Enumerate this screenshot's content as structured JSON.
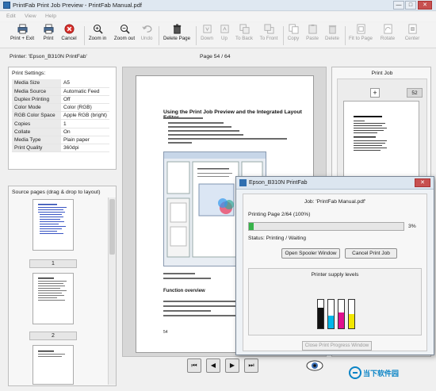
{
  "window": {
    "title": "PrintFab Print Job Preview - PrintFab Manual.pdf",
    "minimize": "—",
    "maximize": "□",
    "close": "✕"
  },
  "menu": [
    "Edit",
    "View",
    "Help"
  ],
  "toolbar": {
    "print_exit": "Print + Exit",
    "print": "Print",
    "cancel": "Cancel",
    "zoom_in": "Zoom in",
    "zoom_out": "Zoom out",
    "undo": "Undo",
    "delete_page": "Delete Page",
    "down": "Down",
    "up": "Up",
    "to_back": "To Back",
    "to_front": "To Front",
    "copy": "Copy",
    "paste": "Paste",
    "delete": "Delete",
    "fit_to_page": "Fit to Page",
    "rotate": "Rotate",
    "center": "Center"
  },
  "printer_label": "Printer: 'Epson_B310N PrintFab'",
  "page_indicator": "Page 54 / 64",
  "settings": {
    "header": "Print Settings:",
    "rows": [
      [
        "Media Size",
        "A5"
      ],
      [
        "Media Source",
        "Automatic Feed"
      ],
      [
        "Duplex Printing",
        "Off"
      ],
      [
        "Color Mode",
        "Color (RGB)"
      ],
      [
        "RGB Color Space",
        "Apple RGB (bright)"
      ],
      [
        "Copies",
        "1"
      ],
      [
        "Collate",
        "On"
      ],
      [
        "Media Type",
        "Plain paper"
      ],
      [
        "Print Quality",
        "360dpi"
      ]
    ]
  },
  "source": {
    "header": "Source pages (drag & drop to layout)",
    "pages": [
      "1",
      "2"
    ]
  },
  "document": {
    "title": "Using the Print Job Preview and the Integrated Layout Editor",
    "section": "Function overview",
    "page_num": "54"
  },
  "printjob": {
    "header": "Print Job",
    "add": "+",
    "count": "52"
  },
  "popup": {
    "title": "Epson_B310N PrintFab",
    "job": "Job: 'PrintFab Manual.pdf'",
    "printing": "Printing Page 2/64 (100%)",
    "percent": "3%",
    "progress": 0.03,
    "status": "Status: Printing / Waiting",
    "open_spooler": "Open Spooler Window",
    "cancel_job": "Cancel Print Job",
    "supply_header": "Printer supply levels",
    "close_progress": "Close Print Progress Window",
    "inks": [
      {
        "name": "black",
        "color": "#111111",
        "level": 0.72
      },
      {
        "name": "cyan",
        "color": "#00b7eb",
        "level": 0.45
      },
      {
        "name": "magenta",
        "color": "#e0108f",
        "level": 0.55
      },
      {
        "name": "yellow",
        "color": "#f2e600",
        "level": 0.5
      }
    ]
  },
  "watermark": "当下软件园"
}
